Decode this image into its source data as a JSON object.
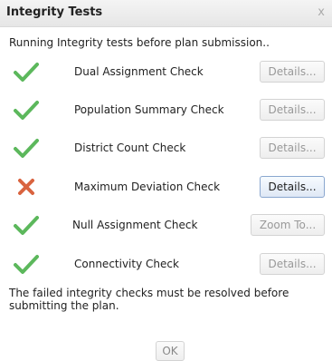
{
  "dialog": {
    "title": "Integrity Tests",
    "close_glyph": "x"
  },
  "intro": "Running Integrity tests before plan submission..",
  "checks": [
    {
      "label": "Dual Assignment Check",
      "status": "pass",
      "icon": "checkmark-icon",
      "button": "Details..."
    },
    {
      "label": "Population Summary Check",
      "status": "pass",
      "icon": "checkmark-icon",
      "button": "Details..."
    },
    {
      "label": "District Count Check",
      "status": "pass",
      "icon": "checkmark-icon",
      "button": "Details..."
    },
    {
      "label": "Maximum Deviation Check",
      "status": "fail",
      "icon": "x-mark-icon",
      "button": "Details..."
    },
    {
      "label": "Null Assignment Check",
      "status": "pass",
      "icon": "checkmark-icon",
      "button": "Zoom To..."
    },
    {
      "label": "Connectivity Check",
      "status": "pass",
      "icon": "checkmark-icon",
      "button": "Details..."
    }
  ],
  "footer": "The failed integrity checks must be resolved before submitting the plan.",
  "ok_label": "OK",
  "colors": {
    "pass": "#5cb85c",
    "fail": "#d9633f"
  }
}
